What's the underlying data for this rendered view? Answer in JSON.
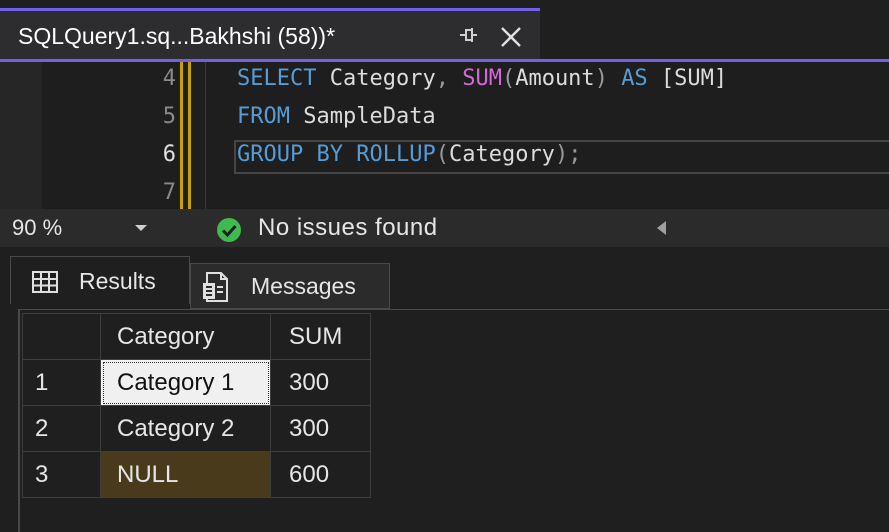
{
  "tab": {
    "title": "SQLQuery1.sq...Bakhshi (58))*"
  },
  "editor": {
    "lines": [
      {
        "number": "4",
        "tokens": [
          {
            "t": "SELECT",
            "c": "kw"
          },
          {
            "t": " Category",
            "c": ""
          },
          {
            "t": ",",
            "c": "punct"
          },
          {
            "t": " ",
            "c": ""
          },
          {
            "t": "SUM",
            "c": "fn"
          },
          {
            "t": "(",
            "c": "punct"
          },
          {
            "t": "Amount",
            "c": ""
          },
          {
            "t": ")",
            "c": "punct"
          },
          {
            "t": " ",
            "c": ""
          },
          {
            "t": "AS",
            "c": "kw"
          },
          {
            "t": " [SUM]",
            "c": ""
          }
        ]
      },
      {
        "number": "5",
        "tokens": [
          {
            "t": "FROM",
            "c": "kw"
          },
          {
            "t": " SampleData",
            "c": ""
          }
        ]
      },
      {
        "number": "6",
        "tokens": [
          {
            "t": "GROUP",
            "c": "kw"
          },
          {
            "t": " ",
            "c": ""
          },
          {
            "t": "BY",
            "c": "kw"
          },
          {
            "t": " ",
            "c": ""
          },
          {
            "t": "ROLLUP",
            "c": "kw"
          },
          {
            "t": "(",
            "c": "punct"
          },
          {
            "t": "Category",
            "c": ""
          },
          {
            "t": ")",
            "c": "punct"
          },
          {
            "t": ";",
            "c": "punct"
          }
        ]
      },
      {
        "number": "7",
        "tokens": []
      }
    ],
    "current_line": "6"
  },
  "status": {
    "zoom": "90 %",
    "issues": "No issues found"
  },
  "results": {
    "tabs": {
      "results": "Results",
      "messages": "Messages"
    },
    "columns": [
      "Category",
      "SUM"
    ],
    "rows": [
      {
        "n": "1",
        "category": "Category 1",
        "sum": "300"
      },
      {
        "n": "2",
        "category": "Category 2",
        "sum": "300"
      },
      {
        "n": "3",
        "category": "NULL",
        "sum": "600"
      }
    ]
  },
  "colors": {
    "accent": "#7160e8",
    "keyword": "#569cd6",
    "function": "#d468d8",
    "null_cell": "#4a3a1c",
    "success": "#3fb950"
  }
}
